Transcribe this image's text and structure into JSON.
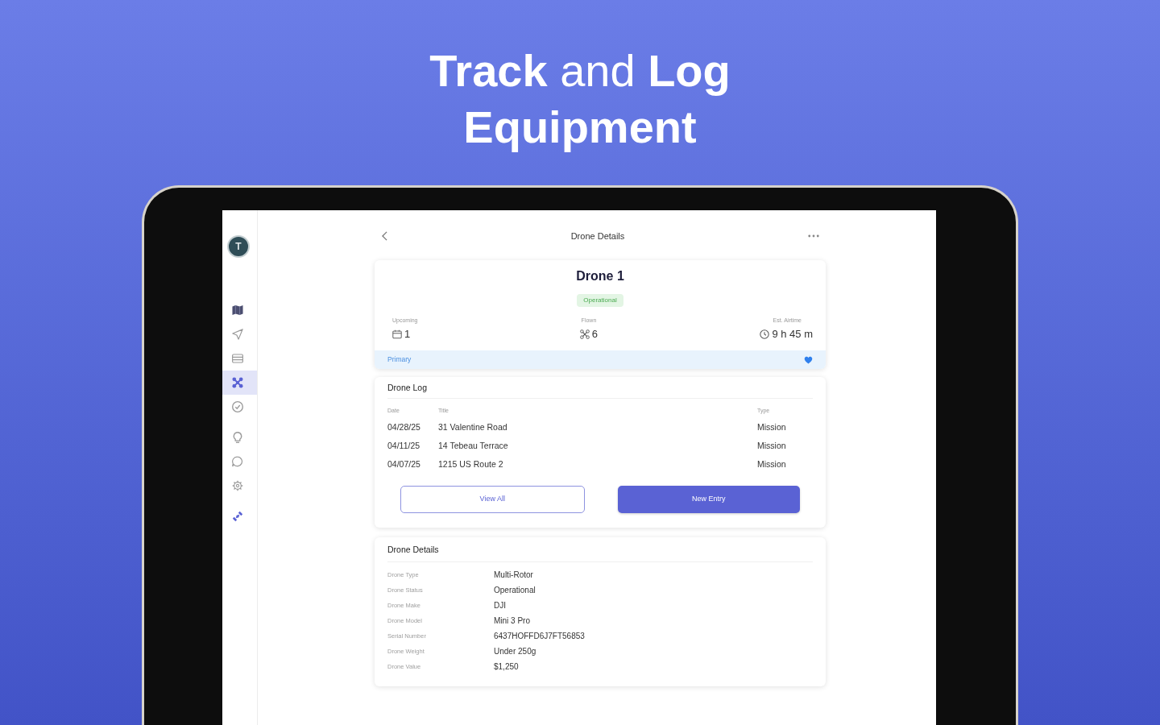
{
  "headline": "**Track** and **Log Equipment**",
  "sidebar": {
    "avatar_initial": "T",
    "groups": [
      [
        {
          "kind": "map",
          "selected": false
        },
        {
          "kind": "send",
          "selected": false
        },
        {
          "kind": "list",
          "selected": false
        },
        {
          "kind": "drone",
          "selected": true
        },
        {
          "kind": "verified",
          "selected": false
        }
      ],
      [
        {
          "kind": "lightbulb",
          "selected": false
        },
        {
          "kind": "chat",
          "selected": false
        },
        {
          "kind": "settings",
          "selected": false
        }
      ],
      [
        {
          "kind": "satellite",
          "selected": false
        }
      ]
    ]
  },
  "header": {
    "title": "Drone Details"
  },
  "drone": {
    "name": "Drone 1",
    "status": "Operational",
    "stats": [
      {
        "kind": "calendar",
        "label": "Upcoming",
        "value": "1"
      },
      {
        "kind": "drone",
        "label": "Flown",
        "value": "6"
      },
      {
        "kind": "clock",
        "label": "Est. Airtime",
        "value": "9 h 45 m"
      }
    ],
    "tag": {
      "label": "Primary",
      "favorite": true
    }
  },
  "drone_log": {
    "title": "Drone Log",
    "columns": [
      "Date",
      "Title",
      "Type"
    ],
    "rows": [
      [
        "04/28/25",
        "31 Valentine Road",
        "Mission"
      ],
      [
        "04/11/25",
        "14 Tebeau Terrace",
        "Mission"
      ],
      [
        "04/07/25",
        "1215 US Route 2",
        "Mission"
      ]
    ],
    "buttons": [
      {
        "kind": "outline",
        "label": "View All"
      },
      {
        "kind": "primary",
        "label": "New Entry"
      }
    ]
  },
  "drone_details": {
    "title": "Drone Details",
    "rows": [
      {
        "label": "Drone Type",
        "value": "Multi-Rotor"
      },
      {
        "label": "Drone Status",
        "value": "Operational"
      },
      {
        "label": "Drone Make",
        "value": "DJI"
      },
      {
        "label": "Drone Model",
        "value": "Mini 3 Pro"
      },
      {
        "label": "Serial Number",
        "value": "6437HOFFD6J7FT56853"
      },
      {
        "label": "Drone Weight",
        "value": "Under 250g"
      },
      {
        "label": "Drone Value",
        "value": "$1,250"
      }
    ]
  }
}
